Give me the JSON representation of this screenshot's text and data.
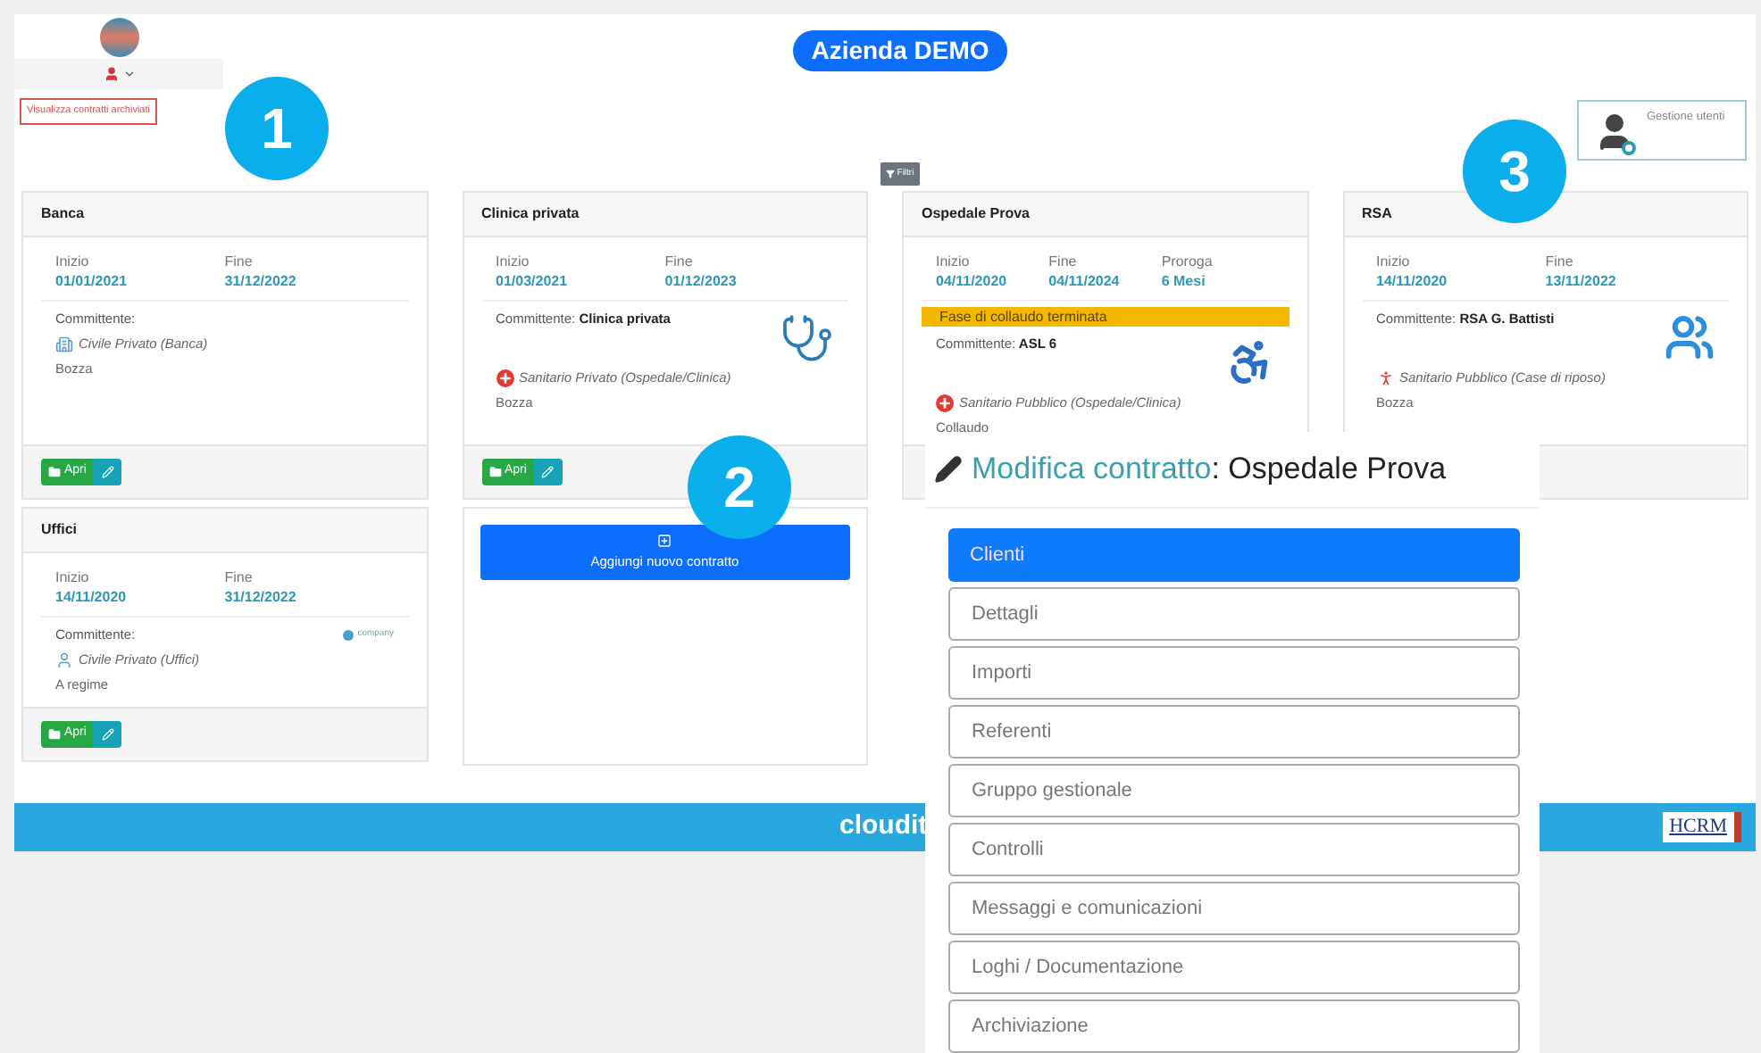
{
  "header": {
    "company": "Azienda DEMO",
    "archive_button": "Visualizza contratti archiviati",
    "filter_button": "Filtri",
    "users_button": "Gestione utenti"
  },
  "columns": [
    [
      {
        "kind": "contract",
        "title": "Banca",
        "dates": [
          {
            "label": "Inizio",
            "value": "01/01/2021"
          },
          {
            "label": "Fine",
            "value": "31/12/2022"
          }
        ],
        "committente_label": "Committente:",
        "category": {
          "kind": "building",
          "label": "Civile Privato (Banca)"
        },
        "status": "Bozza",
        "open_button": "Apri"
      },
      {
        "kind": "contract",
        "title": "Uffici",
        "dates": [
          {
            "label": "Inizio",
            "value": "14/11/2020"
          },
          {
            "label": "Fine",
            "value": "31/12/2022"
          }
        ],
        "committente_label": "Committente:",
        "logo_text": "company",
        "category": {
          "kind": "person",
          "label": "Civile Privato (Uffici)"
        },
        "status": "A regime",
        "open_button": "Apri"
      }
    ],
    [
      {
        "kind": "contract",
        "title": "Clinica privata",
        "dates": [
          {
            "label": "Inizio",
            "value": "01/03/2021"
          },
          {
            "label": "Fine",
            "value": "01/12/2023"
          }
        ],
        "committente_label": "Committente:",
        "committente_name": "Clinica privata",
        "picture": {
          "kind": "stethoscope"
        },
        "category": {
          "kind": "cross",
          "label": "Sanitario Privato (Ospedale/Clinica)"
        },
        "status": "Bozza",
        "open_button": "Apri"
      },
      {
        "kind": "add",
        "label": "Aggiungi nuovo contratto"
      }
    ],
    [
      {
        "kind": "contract",
        "title": "Ospedale Prova",
        "dates": [
          {
            "label": "Inizio",
            "value": "04/11/2020"
          },
          {
            "label": "Fine",
            "value": "04/11/2024"
          },
          {
            "label": "Proroga",
            "value": "6 Mesi"
          }
        ],
        "banner": "Fase di collaudo terminata",
        "committente_label": "Committente:",
        "committente_name": "ASL 6",
        "picture": {
          "kind": "accessibility"
        },
        "category": {
          "kind": "cross",
          "label": "Sanitario Pubblico (Ospedale/Clinica)"
        },
        "status": "Collaudo"
      }
    ],
    [
      {
        "kind": "contract",
        "title": "RSA",
        "dates": [
          {
            "label": "Inizio",
            "value": "14/11/2020"
          },
          {
            "label": "Fine",
            "value": "13/11/2022"
          }
        ],
        "committente_label": "Committente:",
        "committente_name": "RSA G. Battisti",
        "picture": {
          "kind": "elderly"
        },
        "category": {
          "kind": "walker",
          "label": "Sanitario Pubblico (Case di riposo)"
        },
        "status": "Bozza"
      }
    ]
  ],
  "footer": {
    "brand": "cloudit",
    "partner": "HCRM"
  },
  "modal": {
    "title_prefix": "Modifica contratto",
    "title_name": ": Ospedale Prova",
    "items": [
      {
        "label": "Clienti",
        "selected": true
      },
      {
        "label": "Dettagli",
        "selected": false
      },
      {
        "label": "Importi",
        "selected": false
      },
      {
        "label": "Referenti",
        "selected": false
      },
      {
        "label": "Gruppo gestionale",
        "selected": false
      },
      {
        "label": "Controlli",
        "selected": false
      },
      {
        "label": "Messaggi e comunicazioni",
        "selected": false
      },
      {
        "label": "Loghi / Documentazione",
        "selected": false
      },
      {
        "label": "Archiviazione",
        "selected": false
      }
    ]
  },
  "callouts": [
    "1",
    "2",
    "3"
  ]
}
